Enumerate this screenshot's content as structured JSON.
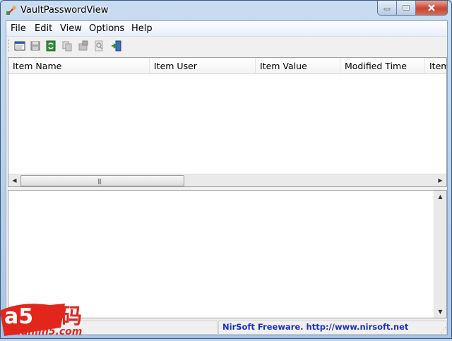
{
  "window": {
    "title": "VaultPasswordView"
  },
  "menu": [
    {
      "label": "File"
    },
    {
      "label": "Edit"
    },
    {
      "label": "View"
    },
    {
      "label": "Options"
    },
    {
      "label": "Help"
    }
  ],
  "toolbar": {
    "icons": [
      "properties-icon",
      "save-icon",
      "refresh-icon",
      "copy-icon",
      "html-report-icon",
      "find-icon",
      "exit-icon"
    ]
  },
  "list": {
    "columns": [
      {
        "label": "Item Name"
      },
      {
        "label": "Item User"
      },
      {
        "label": "Item Value"
      },
      {
        "label": "Modified Time"
      },
      {
        "label": "Item"
      }
    ],
    "rows": []
  },
  "status": {
    "link": "NirSoft Freeware.  http://www.nirsoft.net"
  },
  "watermark": {
    "logo_text": "a5源码",
    "site": "admin5.com"
  },
  "colors": {
    "accent_red": "#e2261c",
    "link_blue": "#1d32c4"
  }
}
